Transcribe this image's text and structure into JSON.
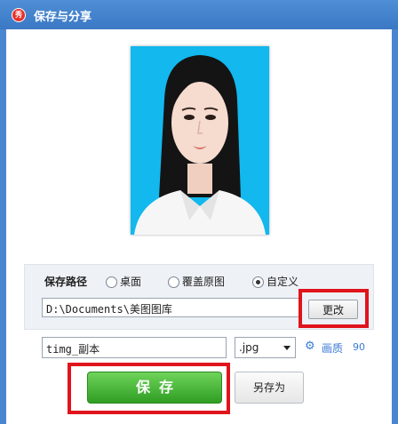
{
  "window": {
    "title": "保存与分享",
    "app_icon_text": "秀"
  },
  "save_path": {
    "label": "保存路径",
    "options": [
      {
        "label": "桌面",
        "selected": false
      },
      {
        "label": "覆盖原图",
        "selected": false
      },
      {
        "label": "自定义",
        "selected": true
      }
    ],
    "path_value": "D:\\Documents\\美图图库",
    "change_button": "更改"
  },
  "file": {
    "name_value": "timg_副本",
    "format": ".jpg",
    "quality_label": "画质",
    "quality_value": "90"
  },
  "actions": {
    "save": "保存",
    "save_as": "另存为"
  },
  "colors": {
    "highlight": "#e0141c",
    "save_green": "#3aaa2c",
    "title_blue": "#3a78c4"
  }
}
